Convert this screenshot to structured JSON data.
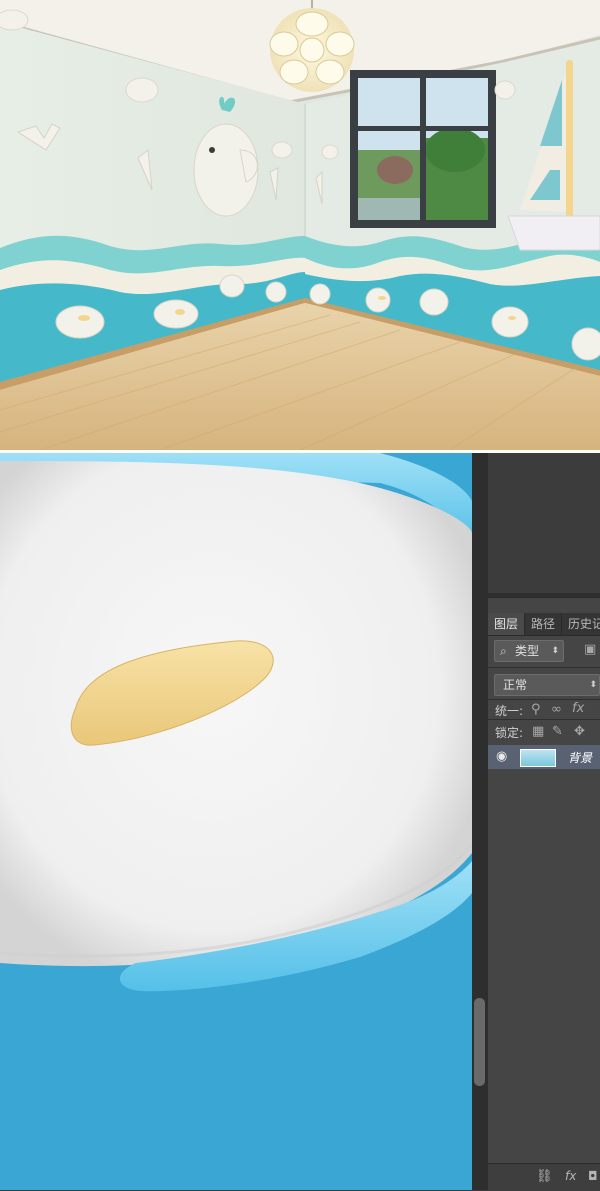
{
  "panel": {
    "tabs": [
      {
        "label": "图层"
      },
      {
        "label": "路径"
      },
      {
        "label": "历史记"
      }
    ],
    "filter": {
      "label": "类型"
    },
    "blend_mode": {
      "value": "正常"
    },
    "unify_label": "统一:",
    "lock_label": "锁定:",
    "layer": {
      "name": "背景"
    },
    "icons": {
      "search": "search-icon",
      "image_filter": "image-filter-icon",
      "eye": "eye-icon",
      "link": "link-icon",
      "fx": "fx-icon"
    }
  },
  "colors": {
    "canvas_blue": "#3aa6d3",
    "fish_body": "#f2f2f2",
    "fish_fin": "#f3d58e",
    "fish_outline": "#6cc9ec",
    "panel_bg": "#454545",
    "selected_layer": "#596272"
  }
}
